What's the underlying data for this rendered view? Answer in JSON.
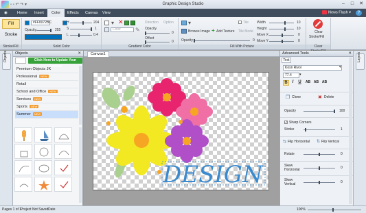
{
  "window": {
    "title": "Graphic Design Studio"
  },
  "menu": {
    "items": [
      "Home",
      "Insert",
      "Color",
      "Effects",
      "Canvas",
      "View"
    ],
    "active": "Color",
    "news_flash": "News Flash",
    "help": "?"
  },
  "ribbon": {
    "stroke_fill": {
      "fill_label": "Fill",
      "stroke_label": "Stroke",
      "group_label": "Stroke/Fill"
    },
    "solid_color": {
      "hex_value": "#FF0072BC",
      "opacity_label": "Opacity",
      "opacity_value": "255",
      "h_label": "H",
      "s_label": "S",
      "l_label": "L",
      "h_value": "204",
      "s_value": "1",
      "l_value": "0.4",
      "group_label": "Solid Color",
      "color": "#0072BC"
    },
    "gradient_color": {
      "type_placeholder": "Color",
      "direction_label": "Direction",
      "option_label": "Option",
      "opacity_label": "Opacity",
      "opacity_value": "0",
      "offset_label": "Offset",
      "offset_value": "0",
      "group_label": "Gradient Color"
    },
    "fill_with_picture": {
      "browse_label": "Browse Image",
      "add_texture_label": "Add Texture",
      "tile_label": "Tile",
      "tile_mode_label": "Tile Mode",
      "opacity_label": "Opacity",
      "opacity_value": "0",
      "group_label": "Fill With Picture"
    },
    "size": {
      "width_label": "Width",
      "width_value": "10",
      "height_label": "Height",
      "height_value": "10",
      "movex_label": "Move X",
      "movex_value": "0",
      "movey_label": "Move Y",
      "movey_value": "0"
    },
    "clear": {
      "label_1": "Clear",
      "label_2": "Stroke/Fill",
      "group_label": "Clear Stroke/Fill"
    }
  },
  "objects_panel": {
    "title": "Objects",
    "update_button": "Click Here to Update Your Content",
    "categories": [
      {
        "label": "Premium Objects JK",
        "new": ""
      },
      {
        "label": "Professional",
        "new": "NEW"
      },
      {
        "label": "Retail",
        "new": ""
      },
      {
        "label": "School and Office",
        "new": "NEW"
      },
      {
        "label": "Services",
        "new": "NEW"
      },
      {
        "label": "Sports",
        "new": "NEW"
      },
      {
        "label": "Summer",
        "new": "NEW"
      }
    ],
    "selected_category": "Summer",
    "sidebar_tab": "Objects"
  },
  "canvas": {
    "tab_label": "Canvas1",
    "design_text": "DESIGN"
  },
  "advanced_tools": {
    "title": "Advanced Tools",
    "tab_label": "Text",
    "font_name": "Kosn Rivol",
    "font_size": "77.4",
    "style_buttons": [
      "B",
      "I",
      "U",
      "AB",
      "AB",
      "AB"
    ],
    "clone_label": "Clone",
    "delete_label": "Delete",
    "opacity_label": "Opacity",
    "opacity_value": "100",
    "sharp_corners_label": "Sharp Corners",
    "stroke_label": "Stroke",
    "stroke_value": "1",
    "flip_h_label": "Flip Horizontal",
    "flip_v_label": "Flip Vertical",
    "rotate_label": "Rotate",
    "rotate_value": "0",
    "skew_h_label_1": "Skew",
    "skew_h_label_2": "Horizontal",
    "skew_h_value": "0",
    "skew_v_label_1": "Skew",
    "skew_v_label_2": "Vertical",
    "skew_v_value": "0",
    "side_tab": "Layers"
  },
  "status": {
    "page": "Pages 1 of 1",
    "saved": "Project Not Saved",
    "date": "Date",
    "zoom": "100%"
  }
}
